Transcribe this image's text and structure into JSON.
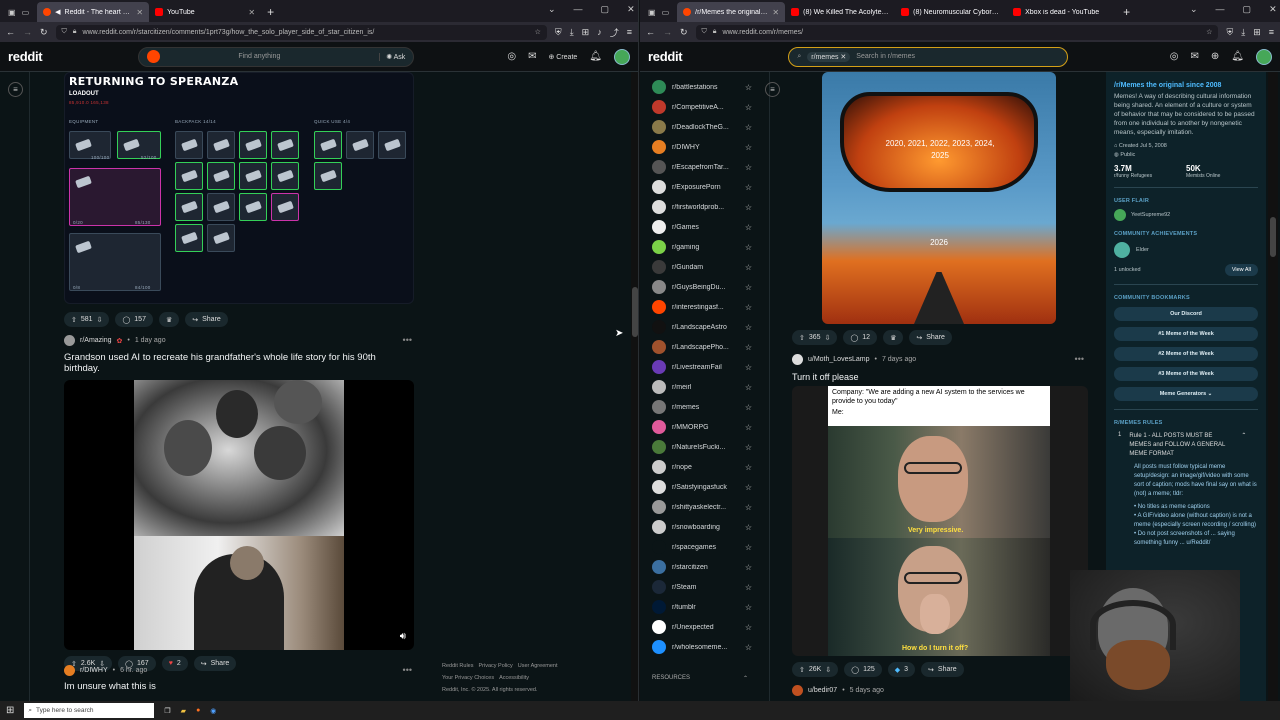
{
  "left_window": {
    "tabs": [
      {
        "title": "Reddit - The heart of the internet",
        "active": true,
        "color": "#ff4500"
      },
      {
        "title": "YouTube",
        "active": false,
        "color": "#ff0000"
      }
    ],
    "url": "www.reddit.com/r/starcitizen/comments/1prt73g/how_the_solo_player_side_of_star_citizen_is/",
    "header": {
      "logo": "reddit",
      "search_placeholder": "Find anything",
      "ask": "Ask",
      "create": "Create"
    },
    "post1": {
      "game_title": "RETURNING TO SPERANZA",
      "loadout": "LOADOUT",
      "loadout_stats": "85,910.0   165,138",
      "sections": {
        "equipment": "EQUIPMENT",
        "backpack": "BACKPACK  14/14",
        "quick": "QUICK USE   4/4"
      },
      "counts": {
        "e1": "100/100",
        "e2": "52/100",
        "e3": "0/20",
        "e4": "85/130",
        "e5": "0/8",
        "e6": "84/100"
      },
      "upvotes": "581",
      "comments": "157",
      "share": "Share"
    },
    "post2": {
      "subreddit": "r/Amazing",
      "time": "1 day ago",
      "title": "Grandson used AI to recreate his grandfather's whole life story for his 90th birthday.",
      "upvotes": "2.6K",
      "comments": "167",
      "awards": "2",
      "share": "Share"
    },
    "post3": {
      "subreddit": "r/DIWHY",
      "time": "6 hr. ago",
      "title": "Im unsure what this is"
    },
    "footer": {
      "links": [
        "Reddit Rules",
        "Privacy Policy",
        "User Agreement",
        "Your Privacy Choices",
        "Accessibility"
      ],
      "copyright": "Reddit, Inc. © 2025. All rights reserved."
    }
  },
  "right_window": {
    "tabs": [
      {
        "title": "/r/Memes the original since 2008",
        "active": true,
        "color": "#ff4500"
      },
      {
        "title": "(8) We Killed The Acolyte, Apparen",
        "active": false,
        "color": "#ff0000"
      },
      {
        "title": "(8) Neuromuscular Cyborg Arm",
        "active": false,
        "color": "#ff0000"
      },
      {
        "title": "Xbox is dead - YouTube",
        "active": false,
        "color": "#ff0000"
      }
    ],
    "url": "www.reddit.com/r/memes/",
    "search_chip": "r/memes",
    "search_placeholder": "Search in r/memes",
    "communities": [
      {
        "name": "r/battlestations",
        "color": "#2e8b57"
      },
      {
        "name": "r/CompetitiveA...",
        "color": "#c0392b"
      },
      {
        "name": "r/DeadlockTheG...",
        "color": "#8a7a4a"
      },
      {
        "name": "r/DIWHY",
        "color": "#e67e22"
      },
      {
        "name": "r/EscapefromTar...",
        "color": "#555555"
      },
      {
        "name": "r/ExposurePorn",
        "color": "#dddddd"
      },
      {
        "name": "r/firstworldprob...",
        "color": "#dddddd"
      },
      {
        "name": "r/Games",
        "color": "#eeeeee"
      },
      {
        "name": "r/gaming",
        "color": "#7bd148"
      },
      {
        "name": "r/Gundam",
        "color": "#3a3a3a"
      },
      {
        "name": "r/GuysBeingDu...",
        "color": "#888888"
      },
      {
        "name": "r/interestingasf...",
        "color": "#ff4500"
      },
      {
        "name": "r/LandscapeAstro",
        "color": "#111111"
      },
      {
        "name": "r/LandscapePho...",
        "color": "#a0522d"
      },
      {
        "name": "r/LivestreamFail",
        "color": "#6a3bb5"
      },
      {
        "name": "r/meirl",
        "color": "#bbbbbb"
      },
      {
        "name": "r/memes",
        "color": "#777777"
      },
      {
        "name": "r/MMORPG",
        "color": "#e05a9a"
      },
      {
        "name": "r/NatureIsFucki...",
        "color": "#4a7a3a"
      },
      {
        "name": "r/nope",
        "color": "#cccccc"
      },
      {
        "name": "r/Satisfyingasfuck",
        "color": "#dddddd"
      },
      {
        "name": "r/shittyaskelectr...",
        "color": "#999999"
      },
      {
        "name": "r/snowboarding",
        "color": "#cccccc"
      },
      {
        "name": "r/spacegames",
        "color": "#0b1416"
      },
      {
        "name": "r/starcitizen",
        "color": "#3b6fa0"
      },
      {
        "name": "r/Steam",
        "color": "#1b2838"
      },
      {
        "name": "r/tumblr",
        "color": "#001935"
      },
      {
        "name": "r/Unexpected",
        "color": "#ffffff"
      },
      {
        "name": "r/wholesomeme...",
        "color": "#1e90ff"
      }
    ],
    "resources_label": "RESOURCES",
    "meme1": {
      "mirror_text": "2020, 2021, 2022, 2023, 2024, 2025",
      "road_text": "2026",
      "upvotes": "365",
      "comments": "12",
      "share": "Share"
    },
    "meme2": {
      "user": "u/Moth_LovesLamp",
      "time": "7 days ago",
      "title": "Turn it off please",
      "caption": "Company: \"We are adding a new AI system to the services we provide to you today\"",
      "me": "Me:",
      "sub1": "Very impressive.",
      "sub2": "How do I turn it off?",
      "upvotes": "26K",
      "comments": "125",
      "awards": "3",
      "share": "Share"
    },
    "meme3": {
      "user": "u/bedir07",
      "time": "5 days ago"
    },
    "sidebar": {
      "title": "/r/Memes the original since 2008",
      "description": "Memes! A way of describing cultural information being shared. An element of a culture or system of behavior that may be considered to be passed from one individual to another by nongenetic means, especially imitation.",
      "created": "Created Jul 5, 2008",
      "visibility": "Public",
      "members": "3.7M",
      "members_label": "r/funny Refugees",
      "online": "50K",
      "online_label": "Memists Online",
      "user_flair_label": "USER FLAIR",
      "user_flair": "YeetSupreme92",
      "achievements_label": "COMMUNITY ACHIEVEMENTS",
      "achievement": "Elder",
      "unlocked": "1 unlocked",
      "view_all": "View All",
      "bookmarks_label": "COMMUNITY BOOKMARKS",
      "bookmarks": [
        "Our Discord",
        "#1 Meme of the Week",
        "#2 Meme of the Week",
        "#3 Meme of the Week",
        "Meme Generators"
      ],
      "rules_label": "R/MEMES RULES",
      "rule1_num": "1",
      "rule1_title": "Rule 1 - ALL POSTS MUST BE MEMES and FOLLOW A GENERAL MEME FORMAT",
      "rule1_body": "All posts must follow typical meme setup/design: an image/gif/video with some sort of caption; mods have final say on what is (not) a meme; tldr:",
      "bullets": [
        "No titles as meme captions",
        "A GIF/video alone (without caption) is not a meme (especially screen recording / scrolling)",
        "Do not post screenshots of ... saying something funny ... u/Reddit/"
      ]
    }
  },
  "taskbar": {
    "search": "Type here to search"
  }
}
